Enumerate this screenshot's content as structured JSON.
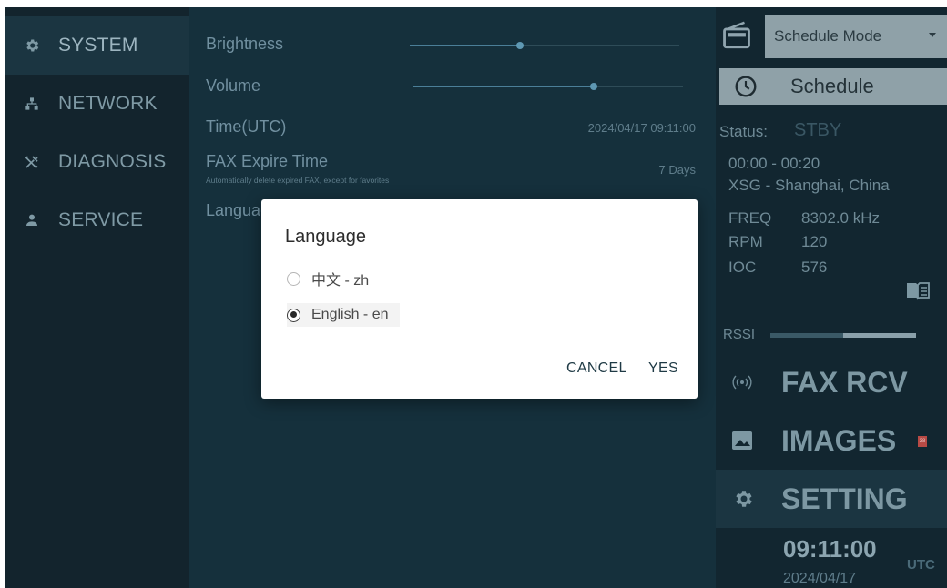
{
  "nav": {
    "items": [
      {
        "label": "SYSTEM",
        "icon": "gear-icon",
        "active": true
      },
      {
        "label": "NETWORK",
        "icon": "network-icon",
        "active": false
      },
      {
        "label": "DIAGNOSIS",
        "icon": "tools-icon",
        "active": false
      },
      {
        "label": "SERVICE",
        "icon": "person-icon",
        "active": false
      }
    ]
  },
  "settings": {
    "brightness": {
      "label": "Brightness",
      "level": 0.41
    },
    "volume": {
      "label": "Volume",
      "level": 0.67
    },
    "time": {
      "label": "Time(UTC)",
      "value": "2024/04/17 09:11:00"
    },
    "fax_expire": {
      "label": "FAX Expire Time",
      "sub": "Automatically delete expired FAX, except for favorites",
      "value": "7 Days"
    },
    "language": {
      "label": "Language"
    }
  },
  "right": {
    "mode_select": {
      "value": "Schedule Mode"
    },
    "schedule_button": {
      "label": "Schedule"
    },
    "status": {
      "label": "Status:",
      "value": "STBY"
    },
    "schedule_time": "00:00 - 00:20",
    "station": "XSG - Shanghai, China",
    "freq": {
      "label": "FREQ",
      "value": "8302.0 kHz"
    },
    "rpm": {
      "label": "RPM",
      "value": "120"
    },
    "ioc": {
      "label": "IOC",
      "value": "576"
    },
    "rssi": {
      "label": "RSSI",
      "level": 0.5
    },
    "fax_rcv": {
      "label": "FAX RCV"
    },
    "images": {
      "label": "IMAGES",
      "badge": "38"
    },
    "setting": {
      "label": "SETTING"
    },
    "clock": {
      "time": "09:11:00",
      "tz": "UTC",
      "date": "2024/04/17"
    }
  },
  "dialog": {
    "title": "Language",
    "options": [
      {
        "label": "中文 - zh",
        "selected": false
      },
      {
        "label": "English - en",
        "selected": true
      }
    ],
    "cancel": "CANCEL",
    "yes": "YES"
  },
  "colors": {
    "background": "#122630",
    "panel": "#15303c",
    "active": "#1b3541",
    "badge": "#b84a45"
  }
}
